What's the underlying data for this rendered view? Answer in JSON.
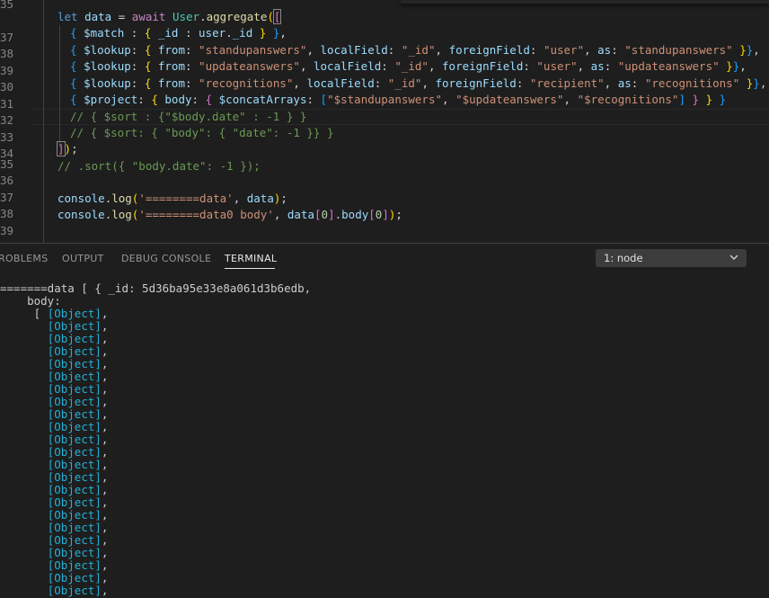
{
  "editor": {
    "line_numbers": [
      "35",
      "37",
      "38",
      "39",
      "30",
      "31",
      "32",
      "33",
      "34",
      "35",
      "36",
      "37",
      "38",
      "39"
    ],
    "lines": {
      "l1": {
        "let": "let",
        "data": "data",
        "eq": " = ",
        "await": "await",
        "sp": " ",
        "User": "User",
        "dot": ".",
        "aggregate": "aggregate",
        "open1": "(",
        "open2": "["
      },
      "l2": {
        "open": "{ ",
        "match": "$match",
        "c1": " : ",
        "open2": "{ ",
        "id": "_id",
        "c2": " : ",
        "user": "user",
        "dot": ".",
        "uid": "_id",
        "close2": " }",
        "close": " }",
        "comma": ","
      },
      "l3": {
        "open": "{ ",
        "key": "$lookup",
        "c": ": ",
        "open2": "{ ",
        "from": "from",
        "c2": ": ",
        "from_v": "\"standupanswers\"",
        "comma1": ", ",
        "lf": "localField",
        "c3": ": ",
        "lf_v": "\"_id\"",
        "comma2": ", ",
        "ff": "foreignField",
        "c4": ": ",
        "ff_v": "\"user\"",
        "comma3": ", ",
        "as": "as",
        "c5": ": ",
        "as_v": "\"standupanswers\"",
        "close2": " }",
        "close": "}",
        "comma": ","
      },
      "l4": {
        "open": "{ ",
        "key": "$lookup",
        "c": ": ",
        "open2": "{ ",
        "from": "from",
        "c2": ": ",
        "from_v": "\"updateanswers\"",
        "comma1": ", ",
        "lf": "localField",
        "c3": ": ",
        "lf_v": "\"_id\"",
        "comma2": ", ",
        "ff": "foreignField",
        "c4": ": ",
        "ff_v": "\"user\"",
        "comma3": ", ",
        "as": "as",
        "c5": ": ",
        "as_v": "\"updateanswers\"",
        "close2": " }",
        "close": "}",
        "comma": ","
      },
      "l5": {
        "open": "{ ",
        "key": "$lookup",
        "c": ": ",
        "open2": "{ ",
        "from": "from",
        "c2": ": ",
        "from_v": "\"recognitions\"",
        "comma1": ", ",
        "lf": "localField",
        "c3": ": ",
        "lf_v": "\"_id\"",
        "comma2": ", ",
        "ff": "foreignField",
        "c4": ": ",
        "ff_v": "\"recipient\"",
        "comma3": ", ",
        "as": "as",
        "c5": ": ",
        "as_v": "\"recognitions\"",
        "close2": " }",
        "close": "}",
        "comma": ","
      },
      "l6": {
        "open": "{ ",
        "key": "$project",
        "c": ": ",
        "open2": "{ ",
        "body": "body",
        "c2": ": ",
        "open3": "{ ",
        "concat": "$concatArrays",
        "c3": ": ",
        "arr_open": "[",
        "s1": "\"$standupanswers\"",
        "comma1": ", ",
        "s2": "\"$updateanswers\"",
        "comma2": ", ",
        "s3": "\"$recognitions\"",
        "arr_close": "]",
        "close3": " }",
        "close2": " }",
        "close": " }"
      },
      "l7": "// { $sort : {\"$body.date\" : -1 } }",
      "l8": "// { $sort: { \"body\": { \"date\": -1 }} }",
      "l9": {
        "close1": "]",
        "close2": ")",
        "semi": ";"
      },
      "l10": "// .sort({ \"body.date\": -1 });",
      "l11": "",
      "l12": {
        "console": "console",
        "dot": ".",
        "log": "log",
        "open": "(",
        "str": "'========data'",
        "comma": ", ",
        "data": "data",
        "close": ")",
        "semi": ";"
      },
      "l13": {
        "console": "console",
        "dot": ".",
        "log": "log",
        "open": "(",
        "str": "'========data0 body'",
        "comma": ", ",
        "data": "data",
        "ob1": "[",
        "i0": "0",
        "cb1": "]",
        "dot2": ".",
        "body": "body",
        "ob2": "[",
        "i1": "0",
        "cb2": "]",
        "close": ")",
        "semi": ";"
      }
    }
  },
  "panel": {
    "tabs": [
      {
        "label": "ROBLEMS"
      },
      {
        "label": "OUTPUT"
      },
      {
        "label": "DEBUG CONSOLE"
      },
      {
        "label": "TERMINAL"
      }
    ],
    "active_tab": "TERMINAL",
    "terminal_select": {
      "value": "1: node"
    }
  },
  "terminal": {
    "line1": "=======data [ { _id: 5d36ba95e33e8a061d3b6edb,",
    "line2": "    body:",
    "line3_prefix": "     [ ",
    "object_label": "[Object]",
    "object_suffix": ",",
    "object_count": 23
  },
  "colors": {
    "background": "#1e1e1e",
    "keyword": "#569cd6",
    "string": "#ce9178",
    "comment": "#6a9955",
    "object_link": "#23b0d7"
  }
}
